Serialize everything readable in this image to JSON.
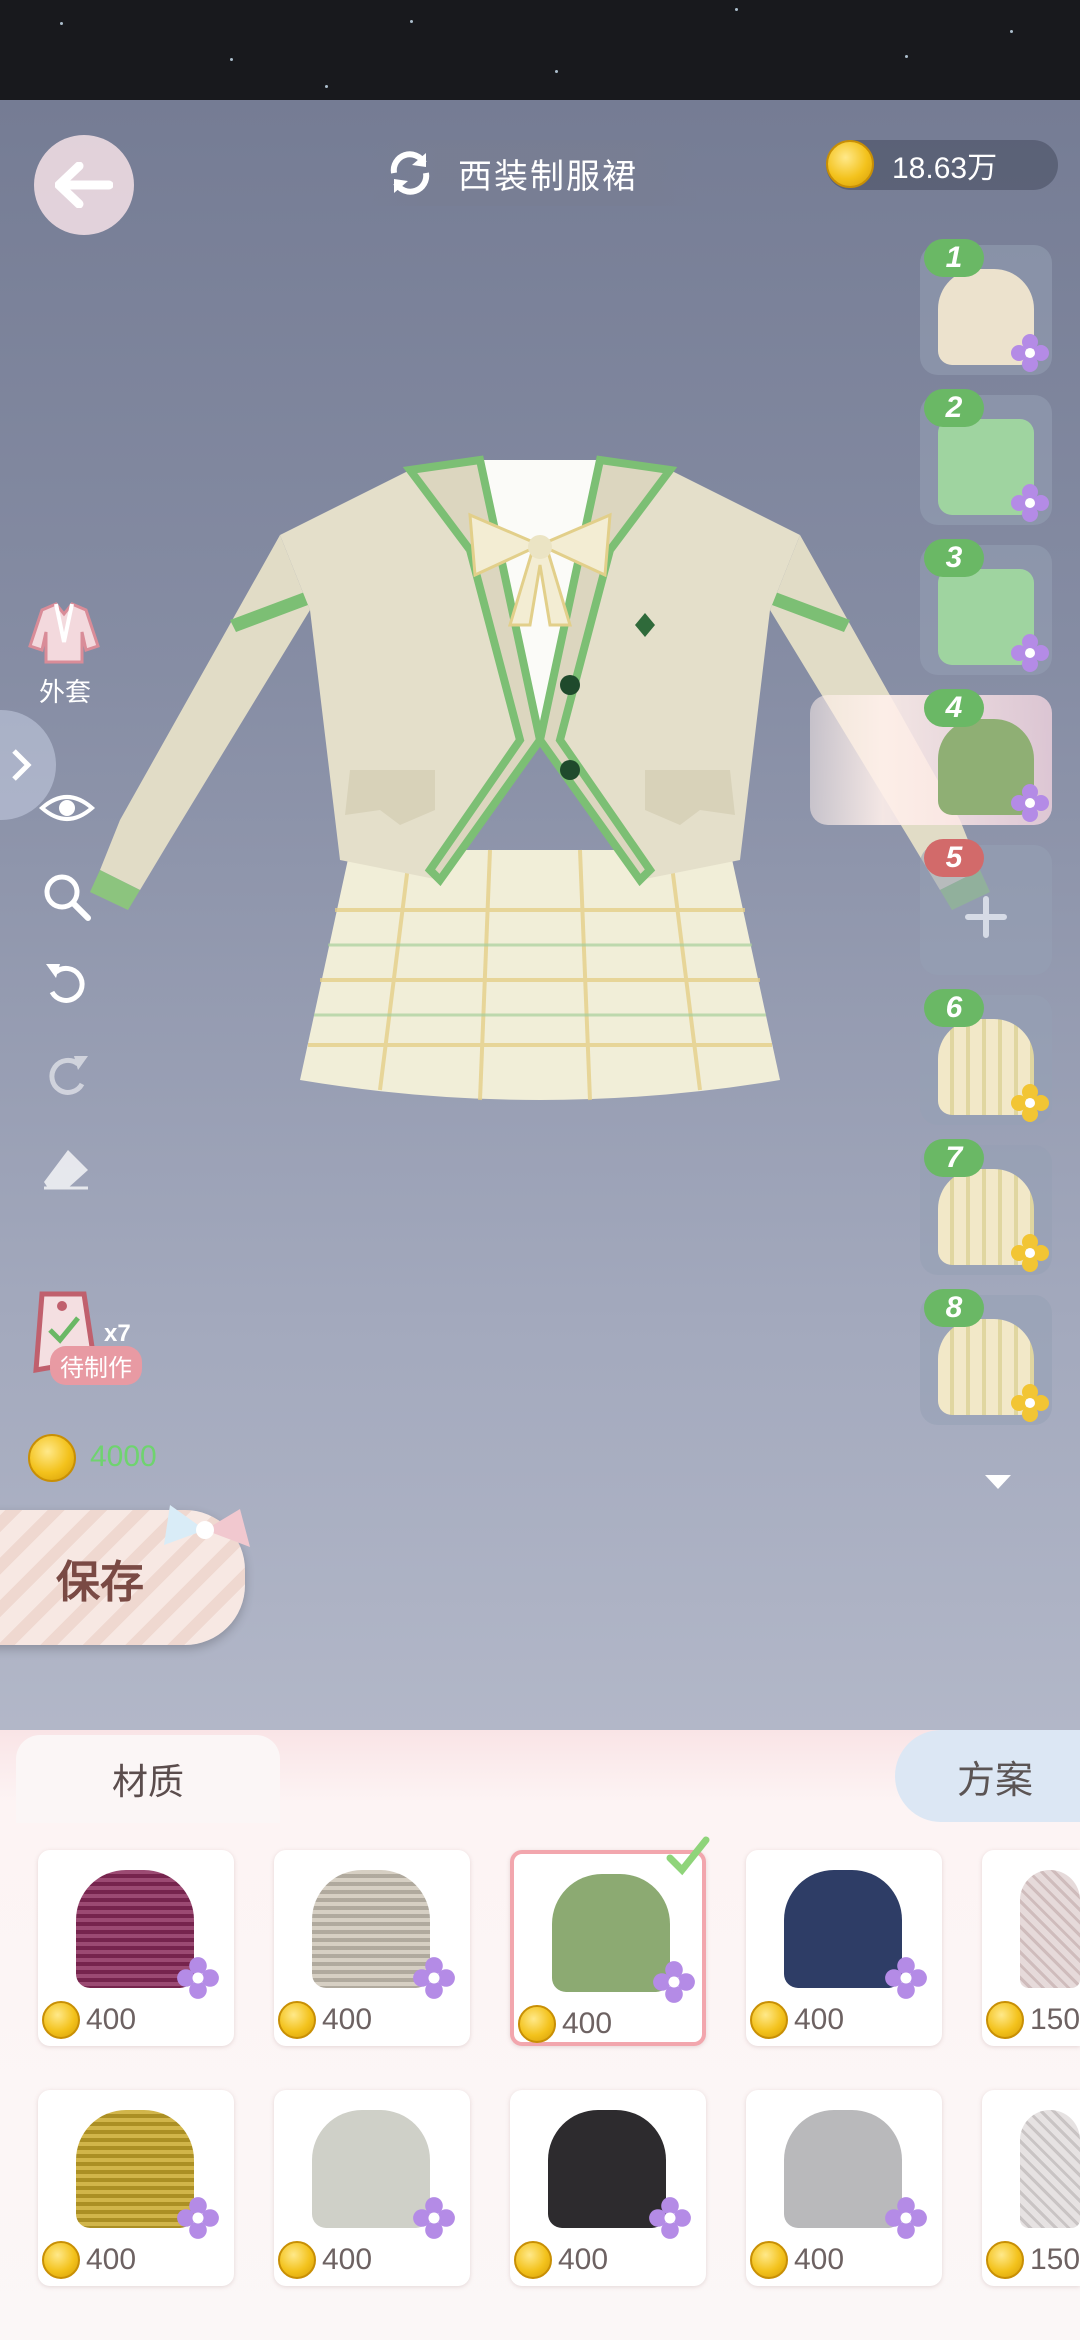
{
  "header": {
    "title": "西装制服裙",
    "balance": "18.63万"
  },
  "tools": {
    "category_label": "外套"
  },
  "pending": {
    "count": "x7",
    "label": "待制作"
  },
  "cost": "4000",
  "save_label": "保存",
  "slots": [
    {
      "num": "1",
      "color": "#ece2cd",
      "badge": "flower-purple"
    },
    {
      "num": "2",
      "color": "#9fd4a0",
      "badge": "flower-purple"
    },
    {
      "num": "3",
      "color": "#9fd4a0",
      "badge": "flower-purple"
    },
    {
      "num": "4",
      "color": "#8faf74",
      "badge": "flower-purple",
      "active": true
    },
    {
      "num": "5",
      "empty": true
    },
    {
      "num": "6",
      "color": "#f2e8c8",
      "badge": "flower-gold"
    },
    {
      "num": "7",
      "color": "#f2e8c8",
      "badge": "flower-gold"
    },
    {
      "num": "8",
      "color": "#f2e8c8",
      "badge": "flower-gold"
    }
  ],
  "tabs": {
    "material": "材质",
    "plan": "方案"
  },
  "materials": [
    {
      "color": "#8a2a5a",
      "price": "400"
    },
    {
      "color": "#cfc7b9",
      "price": "400"
    },
    {
      "color": "#8caa72",
      "price": "400",
      "selected": true
    },
    {
      "color": "#2e3d66",
      "price": "400"
    },
    {
      "color": "#e6dada",
      "price": "150"
    },
    {
      "color": "#c9a82a",
      "price": "400"
    },
    {
      "color": "#cfd0c8",
      "price": "400"
    },
    {
      "color": "#2d2b2e",
      "price": "400"
    },
    {
      "color": "#b9b9bb",
      "price": "400"
    },
    {
      "color": "#e6e2e2",
      "price": "150"
    }
  ],
  "colors": {
    "accent_green": "#6ab865",
    "cost_green": "#6fd36f",
    "selected_border": "#f2a6ad"
  }
}
